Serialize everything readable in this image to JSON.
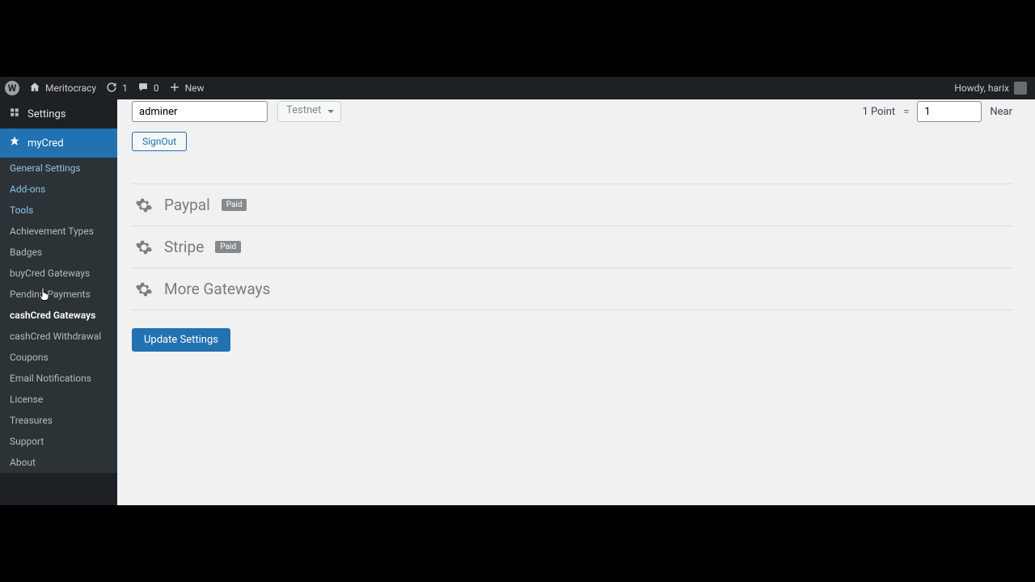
{
  "adminbar": {
    "site_name": "Meritocracy",
    "updates_count": "1",
    "comments_count": "0",
    "new_label": "New",
    "howdy": "Howdy, harix"
  },
  "sidebar": {
    "settings_label": "Settings",
    "mycred_label": "myCred",
    "items": [
      "General Settings",
      "Add-ons",
      "Tools",
      "Achievement Types",
      "Badges",
      "buyCred Gateways",
      "Pending Payments",
      "cashCred Gateways",
      "cashCred Withdrawal",
      "Coupons",
      "Email Notifications",
      "License",
      "Treasures",
      "Support",
      "About"
    ],
    "current_index": 7
  },
  "form": {
    "adminer_value": "adminer",
    "network_options": [
      "Testnet"
    ],
    "network_selected": "Testnet",
    "signout_label": "SignOut",
    "exchange": {
      "left_label": "1 Point",
      "equals": "=",
      "rate_value": "1",
      "currency": "Near"
    }
  },
  "gateways": [
    {
      "name": "Paypal",
      "badge": "Paid"
    },
    {
      "name": "Stripe",
      "badge": "Paid"
    },
    {
      "name": "More Gateways",
      "badge": null
    }
  ],
  "actions": {
    "update_label": "Update Settings"
  }
}
